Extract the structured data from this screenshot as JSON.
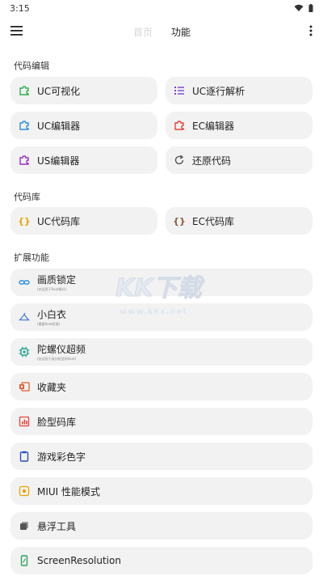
{
  "status": {
    "time": "3:15"
  },
  "tabs": [
    {
      "label": "首页"
    },
    {
      "label": "功能"
    }
  ],
  "sections": {
    "code_edit": {
      "title": "代码编辑",
      "items": [
        {
          "label": "UC可视化",
          "icon": "puzzle-icon",
          "color": "#2bb14a"
        },
        {
          "label": "UC逐行解析",
          "icon": "list-icon",
          "color": "#7a3fd6"
        },
        {
          "label": "UC编辑器",
          "icon": "puzzle-icon",
          "color": "#2f8fe0"
        },
        {
          "label": "EC编辑器",
          "icon": "puzzle-icon",
          "color": "#e5453b"
        },
        {
          "label": "US编辑器",
          "icon": "puzzle-icon",
          "color": "#9b2fc0"
        },
        {
          "label": "还原代码",
          "icon": "refresh-icon",
          "color": "#555555"
        }
      ]
    },
    "code_lib": {
      "title": "代码库",
      "items": [
        {
          "label": "UC代码库",
          "icon": "braces-icon",
          "color": "#e6a300"
        },
        {
          "label": "EC代码库",
          "icon": "braces-icon",
          "color": "#8a5a3c"
        }
      ]
    },
    "extensions": {
      "title": "扩展功能",
      "items": [
        {
          "label": "画质锁定",
          "sub": "(仅适用于Root模式)",
          "icon": "link-icon",
          "color": "#2f8fe0"
        },
        {
          "label": "小白衣",
          "sub": "(需要Root权限)",
          "icon": "hanger-icon",
          "color": "#4a7fd6"
        },
        {
          "label": "陀螺仪超频",
          "sub": "(仅适用于部分机型的Root)",
          "icon": "chip-icon",
          "color": "#1f9e8a"
        },
        {
          "label": "收藏夹",
          "icon": "office-icon",
          "color": "#e55a2b"
        },
        {
          "label": "脸型码库",
          "icon": "chart-icon",
          "color": "#e5453b"
        },
        {
          "label": "游戏彩色字",
          "icon": "clipboard-icon",
          "color": "#2b4fb8"
        },
        {
          "label": "MIUI 性能模式",
          "icon": "target-icon",
          "color": "#e6a300"
        },
        {
          "label": "悬浮工具",
          "icon": "layers-icon",
          "color": "#555555"
        },
        {
          "label": "ScreenResolution",
          "icon": "phone-icon",
          "color": "#2ba35a"
        }
      ]
    }
  },
  "watermark": {
    "logo": "KK下载",
    "url": "www.kkx.net"
  }
}
